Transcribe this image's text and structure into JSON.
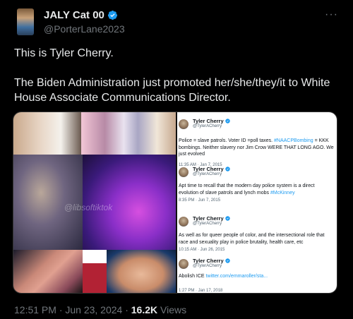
{
  "author": {
    "name": "JALY Cat 00",
    "handle": "@PorterLane2023"
  },
  "menu": {
    "more_label": "···"
  },
  "post": {
    "paragraphs": [
      "This is Tyler Cherry.",
      "The Biden Administration just promoted her/she/they/it to White House Associate Communications Director."
    ]
  },
  "media": {
    "watermark": "@libsoftiktok",
    "embedded_tweets": [
      {
        "name": "Tyler Cherry",
        "handle": "@TylerACherry",
        "body_parts": [
          {
            "text": "Police = slave patrols. Voter ID =poll taxes. ",
            "link": false
          },
          {
            "text": "#NAACPBombing",
            "link": true
          },
          {
            "text": " = KKK bombings. Neither slavery nor Jim Crow WERE THAT LONG AGO. We just evolved",
            "link": false
          }
        ],
        "time": "11:35 AM · Jan 7, 2015"
      },
      {
        "name": "Tyler Cherry",
        "handle": "@TylerACherry",
        "body_parts": [
          {
            "text": "Apt time to recall that the modern day police system is a direct evolution of slave patrols and lynch mobs ",
            "link": false
          },
          {
            "text": "#McKinney",
            "link": true
          }
        ],
        "time": "8:35 PM · Jun 7, 2015"
      },
      {
        "name": "Tyler Cherry",
        "handle": "@TylerACherry",
        "body_parts": [
          {
            "text": "As well as for queer people of color, and the intersectional role that race and sexuality play in police brutality, health care, etc",
            "link": false
          }
        ],
        "time": "10:15 AM · Jun 26, 2015"
      },
      {
        "name": "Tyler Cherry",
        "handle": "@TylerACherry",
        "body_parts": [
          {
            "text": "Abolish ICE ",
            "link": false
          },
          {
            "text": "twitter.com/emmaroller/sta...",
            "link": true
          }
        ],
        "time": "1:27 PM · Jan 17, 2018"
      }
    ]
  },
  "meta": {
    "timestamp": "12:51 PM · Jun 23, 2024 · ",
    "views_count": "16.2K",
    "views_label": " Views"
  },
  "colors": {
    "background": "#000000",
    "text": "#e7e9ea",
    "muted": "#71767b",
    "accent": "#1d9bf0"
  }
}
